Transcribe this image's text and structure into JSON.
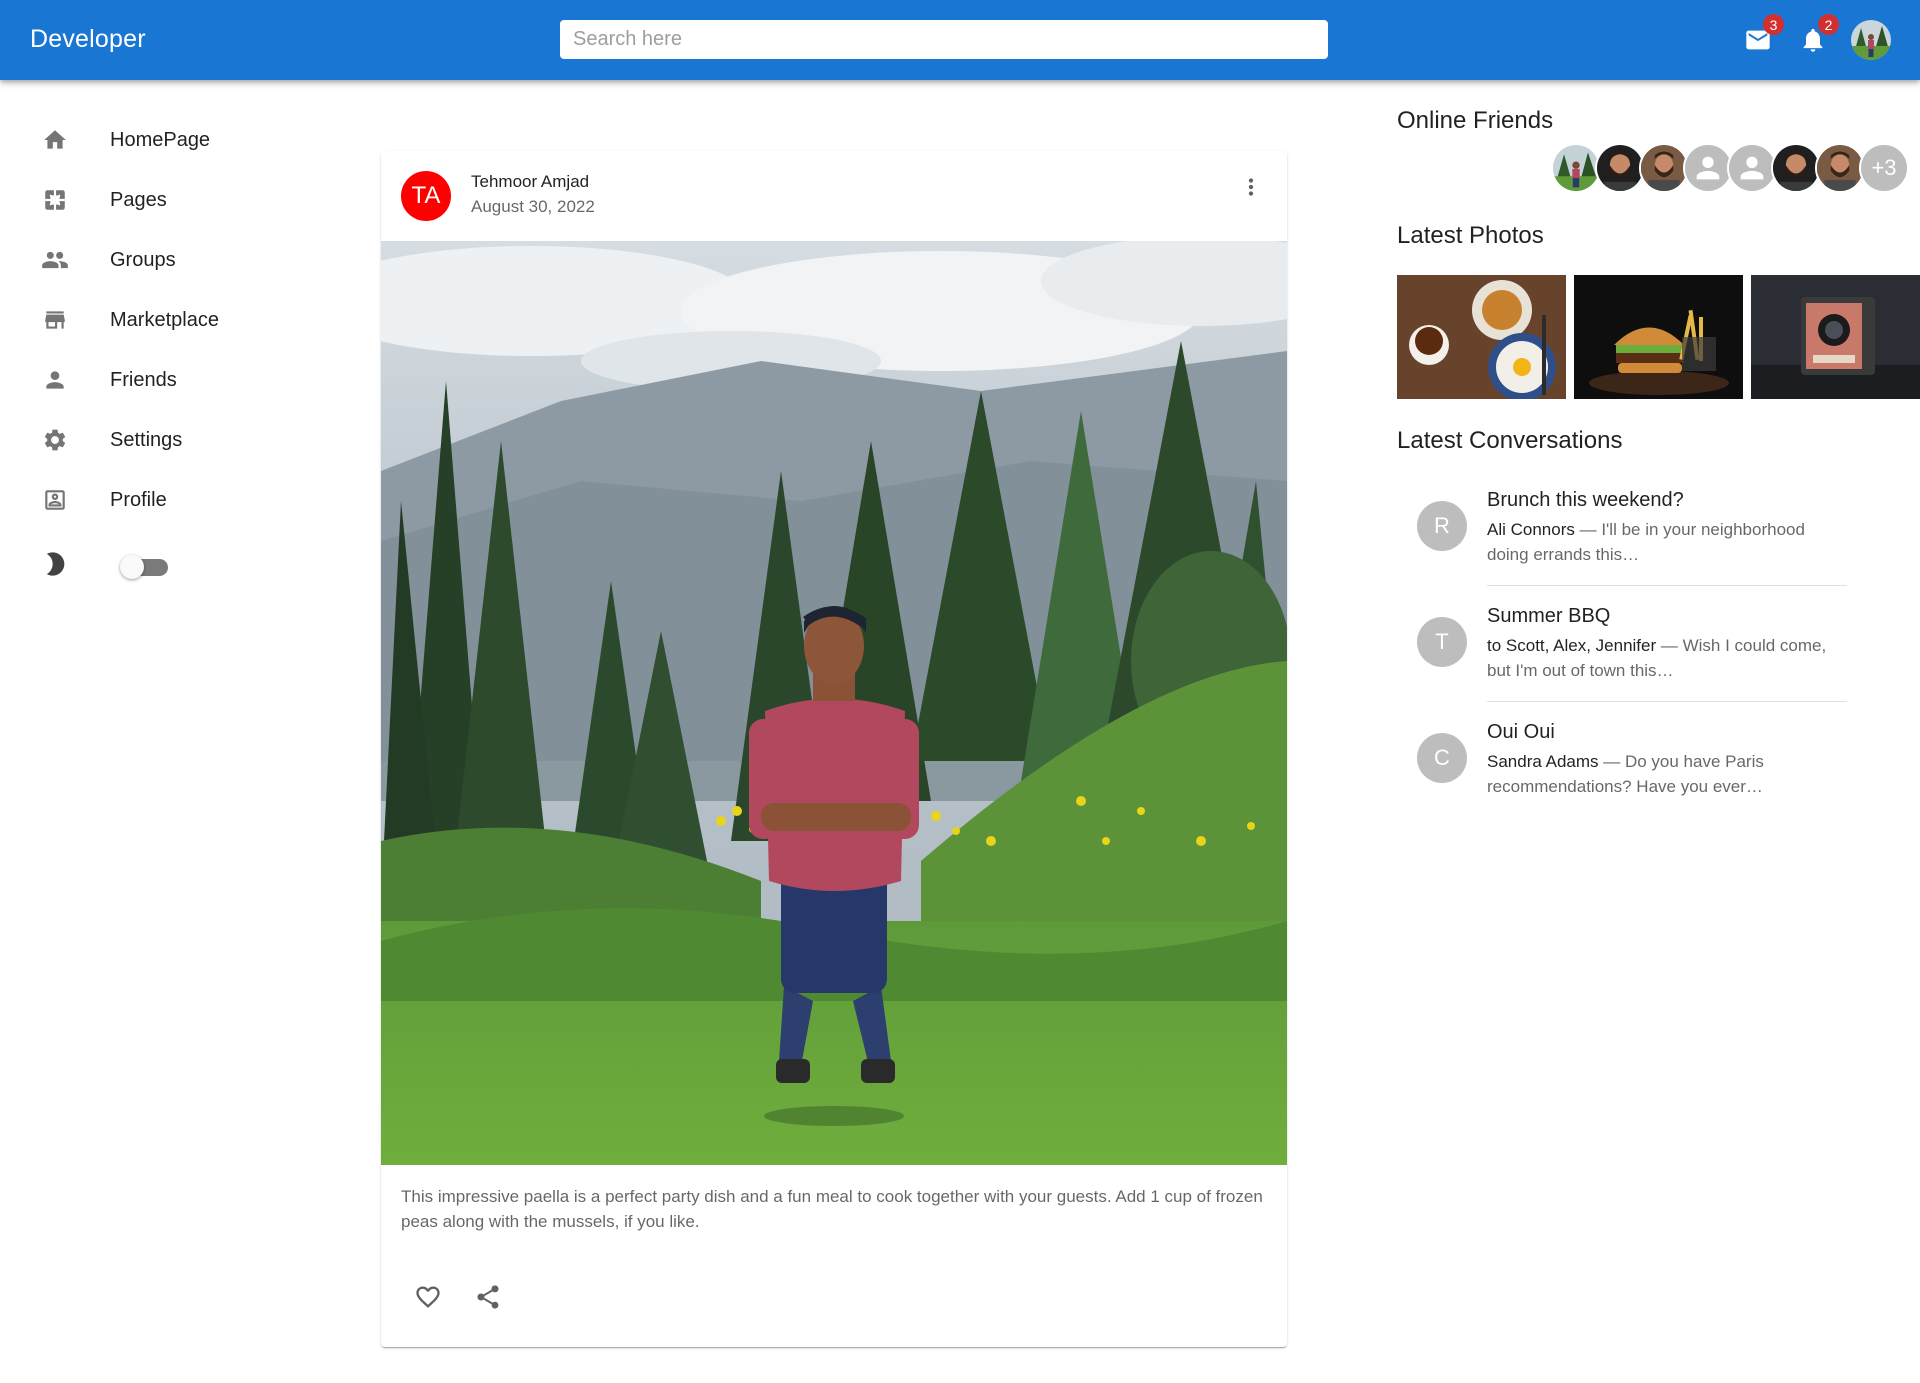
{
  "appbar": {
    "brand": "Developer",
    "search_placeholder": "Search here",
    "mail_count": "3",
    "notification_count": "2",
    "color": "#1976d2"
  },
  "sidebar": {
    "items": [
      {
        "label": "HomePage",
        "icon": "home-icon"
      },
      {
        "label": "Pages",
        "icon": "pages-icon"
      },
      {
        "label": "Groups",
        "icon": "groups-icon"
      },
      {
        "label": "Marketplace",
        "icon": "storefront-icon"
      },
      {
        "label": "Friends",
        "icon": "person-icon"
      },
      {
        "label": "Settings",
        "icon": "settings-icon"
      },
      {
        "label": "Profile",
        "icon": "account-box-icon"
      }
    ],
    "dark_mode": false
  },
  "post": {
    "avatar_initials": "TA",
    "author": "Tehmoor Amjad",
    "date": "August 30, 2022",
    "caption": "This impressive paella is a perfect party dish and a fun meal to cook together with your guests. Add 1 cup of frozen peas along with the mussels, if you like.",
    "avatar_color": "#ff0000"
  },
  "right": {
    "online_friends_title": "Online Friends",
    "more_friends": "+3",
    "latest_photos_title": "Latest Photos",
    "latest_conversations_title": "Latest Conversations",
    "conversations": [
      {
        "initial": "R",
        "title": "Brunch this weekend?",
        "who": "Ali Connors",
        "text": " — I'll be in your neighborhood doing errands this…"
      },
      {
        "initial": "T",
        "title": "Summer BBQ",
        "who": "to Scott, Alex, Jennifer",
        "text": " — Wish I could come, but I'm out of town this…"
      },
      {
        "initial": "C",
        "title": "Oui Oui",
        "who": "Sandra Adams",
        "text": " — Do you have Paris recommendations? Have you ever…"
      }
    ]
  }
}
